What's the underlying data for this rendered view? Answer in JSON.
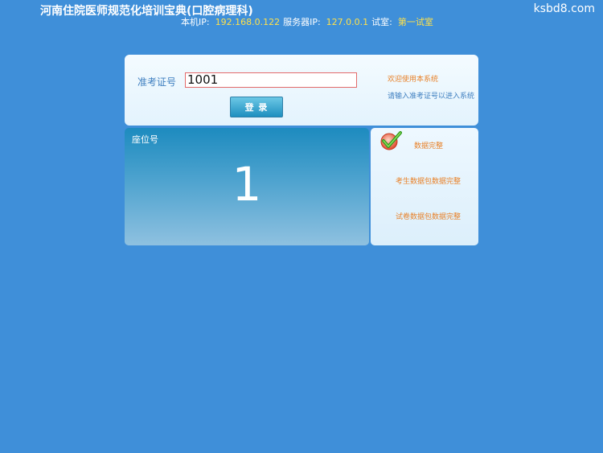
{
  "header": {
    "app_title": "河南住院医师规范化培训宝典(口腔病理科)",
    "watermark": "ksbd8.com",
    "local_ip_label": "本机IP:",
    "local_ip": "192.168.0.122",
    "server_ip_label": "服务器IP:",
    "server_ip": "127.0.0.1",
    "room_label": "试室:",
    "room": "第一试室"
  },
  "login": {
    "exam_number_label": "准考证号",
    "exam_number_value": "1001",
    "login_button_label": "登 录",
    "welcome_text": "欢迎使用本系统",
    "hint_text": "请输入准考证号以进入系统"
  },
  "seat": {
    "label": "座位号",
    "number": "1"
  },
  "data_status": {
    "icon": "check-icon",
    "data_complete": "数据完整",
    "candidate_data_complete": "考生数据包数据完整",
    "paper_data_complete": "试卷数据包数据完整"
  },
  "colors": {
    "background": "#3f8fd9",
    "accent_yellow": "#ffe14a",
    "accent_orange": "#e8822a",
    "label_blue": "#3f7fc0"
  }
}
